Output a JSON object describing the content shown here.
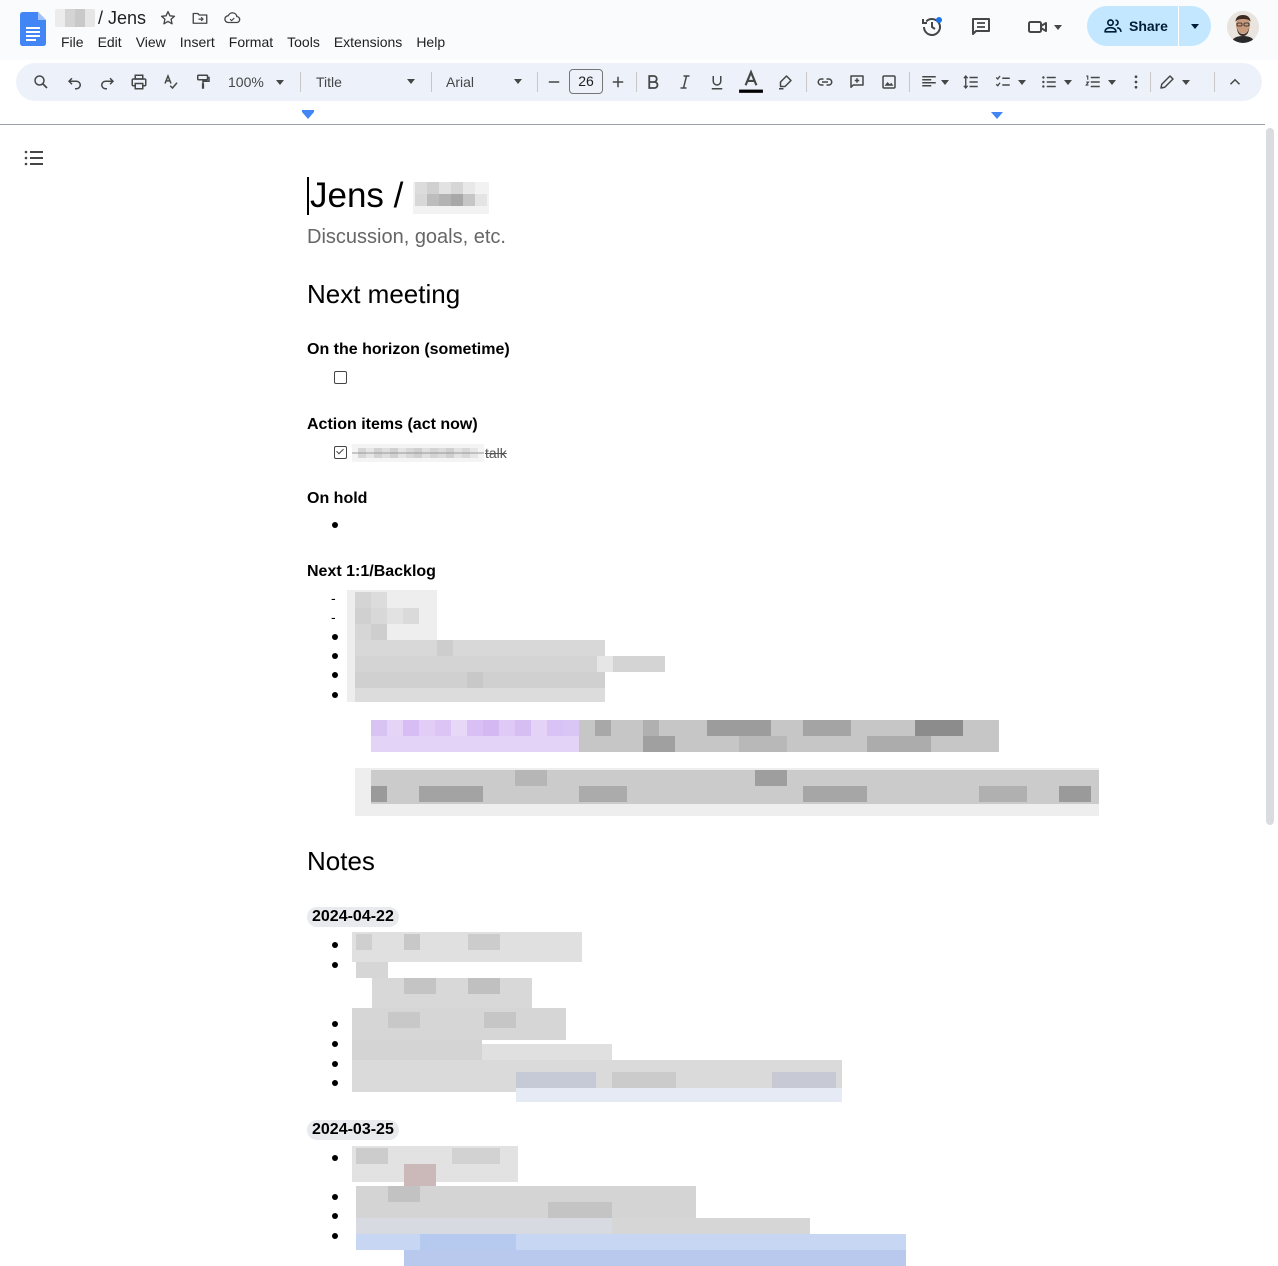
{
  "app": {
    "doc_title": "/ Jens",
    "menu": [
      "File",
      "Edit",
      "View",
      "Insert",
      "Format",
      "Tools",
      "Extensions",
      "Help"
    ],
    "share_label": "Share",
    "icons": [
      "docs-logo-icon",
      "star-icon",
      "move-folder-icon",
      "cloud-status-icon",
      "version-history-icon",
      "comments-icon",
      "meet-icon",
      "share-people-icon",
      "avatar"
    ]
  },
  "toolbar": {
    "zoom": "100%",
    "style": "Title",
    "font": "Arial",
    "font_size": "26"
  },
  "document": {
    "title": "Jens /",
    "subtitle": "Discussion, goals, etc.",
    "next_meeting_heading": "Next meeting",
    "horizon_heading": "On the horizon (sometime)",
    "action_heading": "Action items (act now)",
    "action_item_visible_text": "talk",
    "on_hold_heading": "On hold",
    "backlog_heading": "Next 1:1/Backlog",
    "backlog_dashes": [
      "-",
      "-"
    ],
    "notes_heading": "Notes",
    "note_dates": [
      "2024-04-22",
      "2024-03-25"
    ]
  },
  "colors": {
    "accent": "#1a73e8",
    "share_bg": "#c2e7ff",
    "toolbar_bg": "#edf2fa",
    "titlebar_bg": "#f9fbfd"
  }
}
